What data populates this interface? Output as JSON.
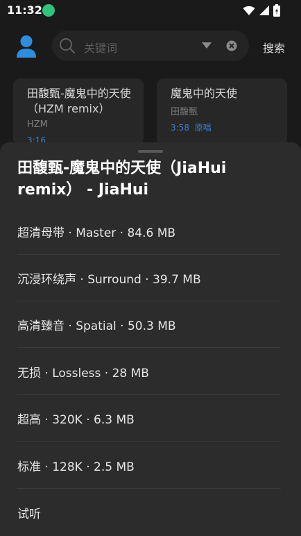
{
  "status_bar": {
    "time": "11:32"
  },
  "header": {
    "search_placeholder": "关键词",
    "search_button": "搜索"
  },
  "results": [
    {
      "title": "田馥甄-魔鬼中的天使（HZM remix）",
      "artist": "HZM",
      "duration": "3:16",
      "tag": ""
    },
    {
      "title": "魔鬼中的天使",
      "artist": "田馥甄",
      "duration": "3:58",
      "tag": "原唱"
    }
  ],
  "sheet": {
    "title": "田馥甄-魔鬼中的天使（JiaHui remix） - JiaHui",
    "options": [
      {
        "label": "超清母带 · Master · 84.6 MB"
      },
      {
        "label": "沉浸环绕声 · Surround · 39.7 MB"
      },
      {
        "label": "高清臻音 · Spatial · 50.3 MB"
      },
      {
        "label": "无损 · Lossless · 28 MB"
      },
      {
        "label": "超高 · 320K · 6.3 MB"
      },
      {
        "label": "标准 · 128K · 2.5 MB"
      },
      {
        "label": "试听"
      }
    ]
  },
  "colors": {
    "background": "#1a1a1a",
    "sheet": "#2c2c2c",
    "accent_blue": "#3d7ccc",
    "app_green": "#31c27c"
  }
}
